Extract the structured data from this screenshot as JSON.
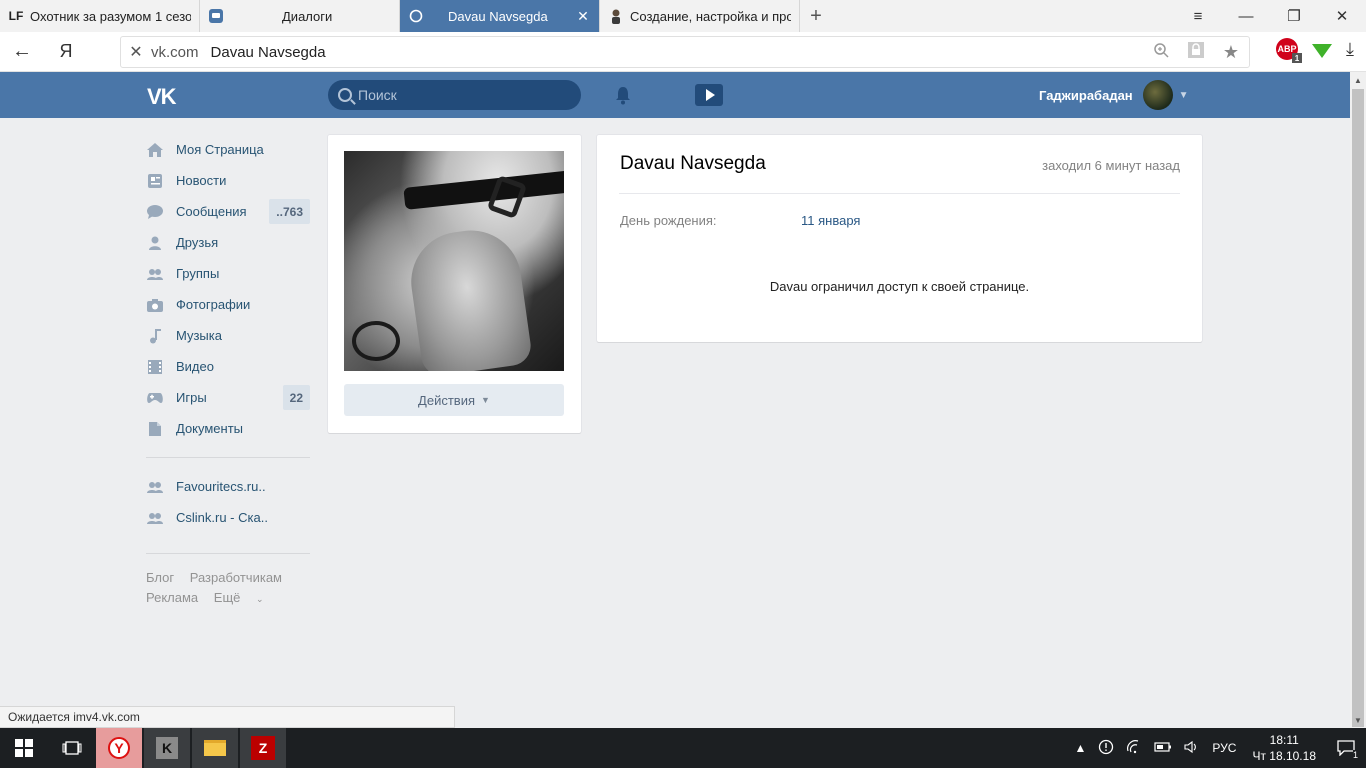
{
  "browser": {
    "tabs": [
      {
        "title": "Охотник за разумом 1 сезо",
        "favicon": "LF"
      },
      {
        "title": "Диалоги",
        "favicon": "vk-message-icon"
      },
      {
        "title": "Davau Navsegda",
        "favicon": "loading-circle-icon",
        "active": true
      },
      {
        "title": "Создание, настройка и про",
        "favicon": "person-icon"
      }
    ],
    "new_tab": "+",
    "window_controls": {
      "menu": "≡",
      "minimize": "—",
      "restore": "❐",
      "close": "✕"
    },
    "back": "←",
    "yandex_button": "Я",
    "address": {
      "stop": "✕",
      "domain": "vk.com",
      "title": "Davau Navsegda"
    },
    "extensions": {
      "adblock_label": "ABP",
      "adblock_count": "1"
    }
  },
  "vk_header": {
    "logo": "VK",
    "search_placeholder": "Поиск",
    "user_name": "Гаджирабадан",
    "colors": {
      "header": "#4a76a8",
      "search_bg": "#224b7a"
    }
  },
  "left_nav": {
    "items": [
      {
        "label": "Моя Страница",
        "icon": "home-icon"
      },
      {
        "label": "Новости",
        "icon": "news-icon"
      },
      {
        "label": "Сообщения",
        "icon": "messages-icon",
        "count": "..763"
      },
      {
        "label": "Друзья",
        "icon": "friends-icon"
      },
      {
        "label": "Группы",
        "icon": "groups-icon"
      },
      {
        "label": "Фотографии",
        "icon": "camera-icon"
      },
      {
        "label": "Музыка",
        "icon": "music-icon"
      },
      {
        "label": "Видео",
        "icon": "video-icon"
      },
      {
        "label": "Игры",
        "icon": "games-icon",
        "count": "22"
      },
      {
        "label": "Документы",
        "icon": "document-icon"
      }
    ],
    "bookmarks": [
      {
        "label": "Favouritecs.ru..",
        "icon": "groups-icon"
      },
      {
        "label": "Cslink.ru - Cка..",
        "icon": "groups-icon"
      }
    ],
    "footer": {
      "blog": "Блог",
      "developers": "Разработчикам",
      "ads": "Реклама",
      "more": "Ещё"
    }
  },
  "profile": {
    "actions_label": "Действия",
    "name": "Davau Navsegda",
    "last_seen": "заходил 6 минут назад",
    "birthday_label": "День рождения:",
    "birthday_value": "11 января",
    "restricted_text": "Davau ограничил доступ к своей странице."
  },
  "status_bar": {
    "text": "Ожидается imv4.vk.com"
  },
  "taskbar": {
    "tray_lang": "РУС",
    "time": "18:11",
    "date": "Чт 18.10.18",
    "notification_count": "1",
    "apps": [
      "yandex-browser-icon",
      "counter-strike-icon",
      "file-explorer-icon",
      "filezilla-icon"
    ]
  }
}
